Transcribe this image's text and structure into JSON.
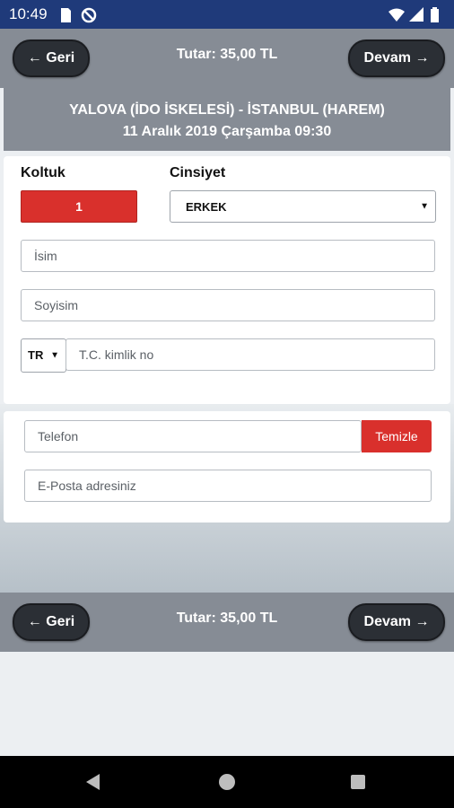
{
  "status": {
    "time": "10:49"
  },
  "top_bar": {
    "back_label": "← Geri",
    "total": "Tutar: 35,00 TL",
    "next_label": "Devam →"
  },
  "route": {
    "line1": "YALOVA (İDO İSKELESİ) - İSTANBUL (HAREM)",
    "line2": "11 Aralık 2019 Çarşamba 09:30"
  },
  "passenger": {
    "seat_label": "Koltuk",
    "seat_value": "1",
    "gender_label": "Cinsiyet",
    "gender_value": "ERKEK",
    "name_placeholder": "İsim",
    "surname_placeholder": "Soyisim",
    "country_code": "TR",
    "id_placeholder": "T.C. kimlik no"
  },
  "contact": {
    "phone_placeholder": "Telefon",
    "clear_label": "Temizle",
    "email_placeholder": "E-Posta adresiniz"
  },
  "bottom_bar": {
    "back_label": "← Geri",
    "total": "Tutar: 35,00 TL",
    "next_label": "Devam →"
  },
  "colors": {
    "status_bar": "#1f3a7a",
    "header": "#868c95",
    "accent_red": "#d9302c",
    "dark_button": "#2b2f35"
  },
  "icons": [
    "sd-card-icon",
    "no-sync-icon",
    "wifi-icon",
    "signal-icon",
    "battery-icon"
  ]
}
